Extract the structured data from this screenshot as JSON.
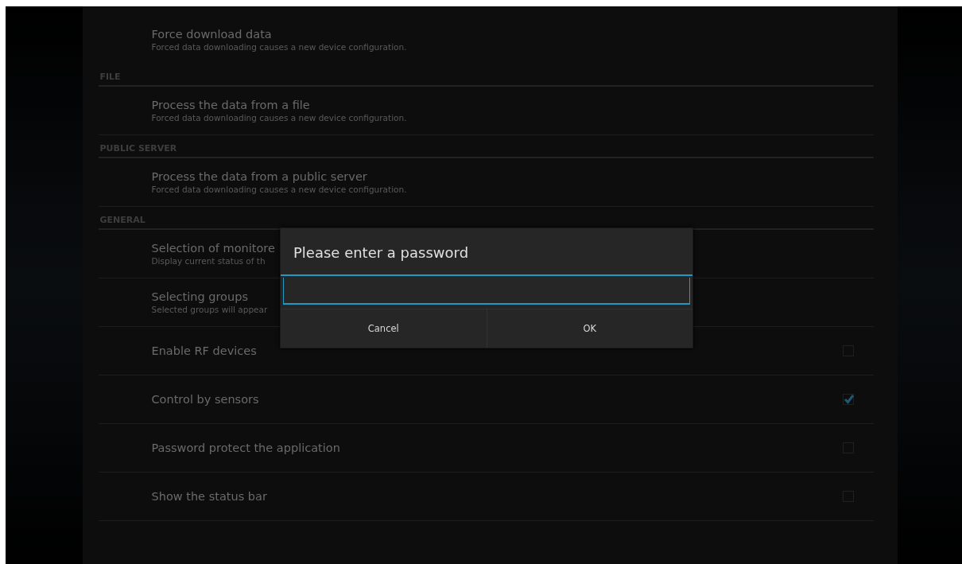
{
  "sections": [
    {
      "items": [
        {
          "kind": "action",
          "title": "Force download data",
          "summary": "Forced data downloading causes a new device configuration."
        }
      ]
    },
    {
      "header": "FILE",
      "items": [
        {
          "kind": "action",
          "title": "Process the data from a file",
          "summary": "Forced data downloading causes a new device configuration."
        }
      ]
    },
    {
      "header": "PUBLIC SERVER",
      "items": [
        {
          "kind": "action",
          "title": "Process the data from a public server",
          "summary": "Forced data downloading causes a new device configuration."
        }
      ]
    },
    {
      "header": "GENERAL",
      "items": [
        {
          "kind": "action",
          "title": "Selection of monitore",
          "summary": "Display current status of th"
        },
        {
          "kind": "action",
          "title": "Selecting groups",
          "summary": "Selected groups will appear"
        },
        {
          "kind": "checkbox",
          "title": "Enable RF devices",
          "checked": false
        },
        {
          "kind": "checkbox",
          "title": "Control by sensors",
          "checked": true
        },
        {
          "kind": "checkbox",
          "title": "Password protect the application",
          "checked": false
        },
        {
          "kind": "checkbox",
          "title": "Show the status bar",
          "checked": false
        }
      ]
    }
  ],
  "dialog": {
    "title": "Please enter a password",
    "buttons": [
      "Cancel",
      "OK"
    ]
  }
}
